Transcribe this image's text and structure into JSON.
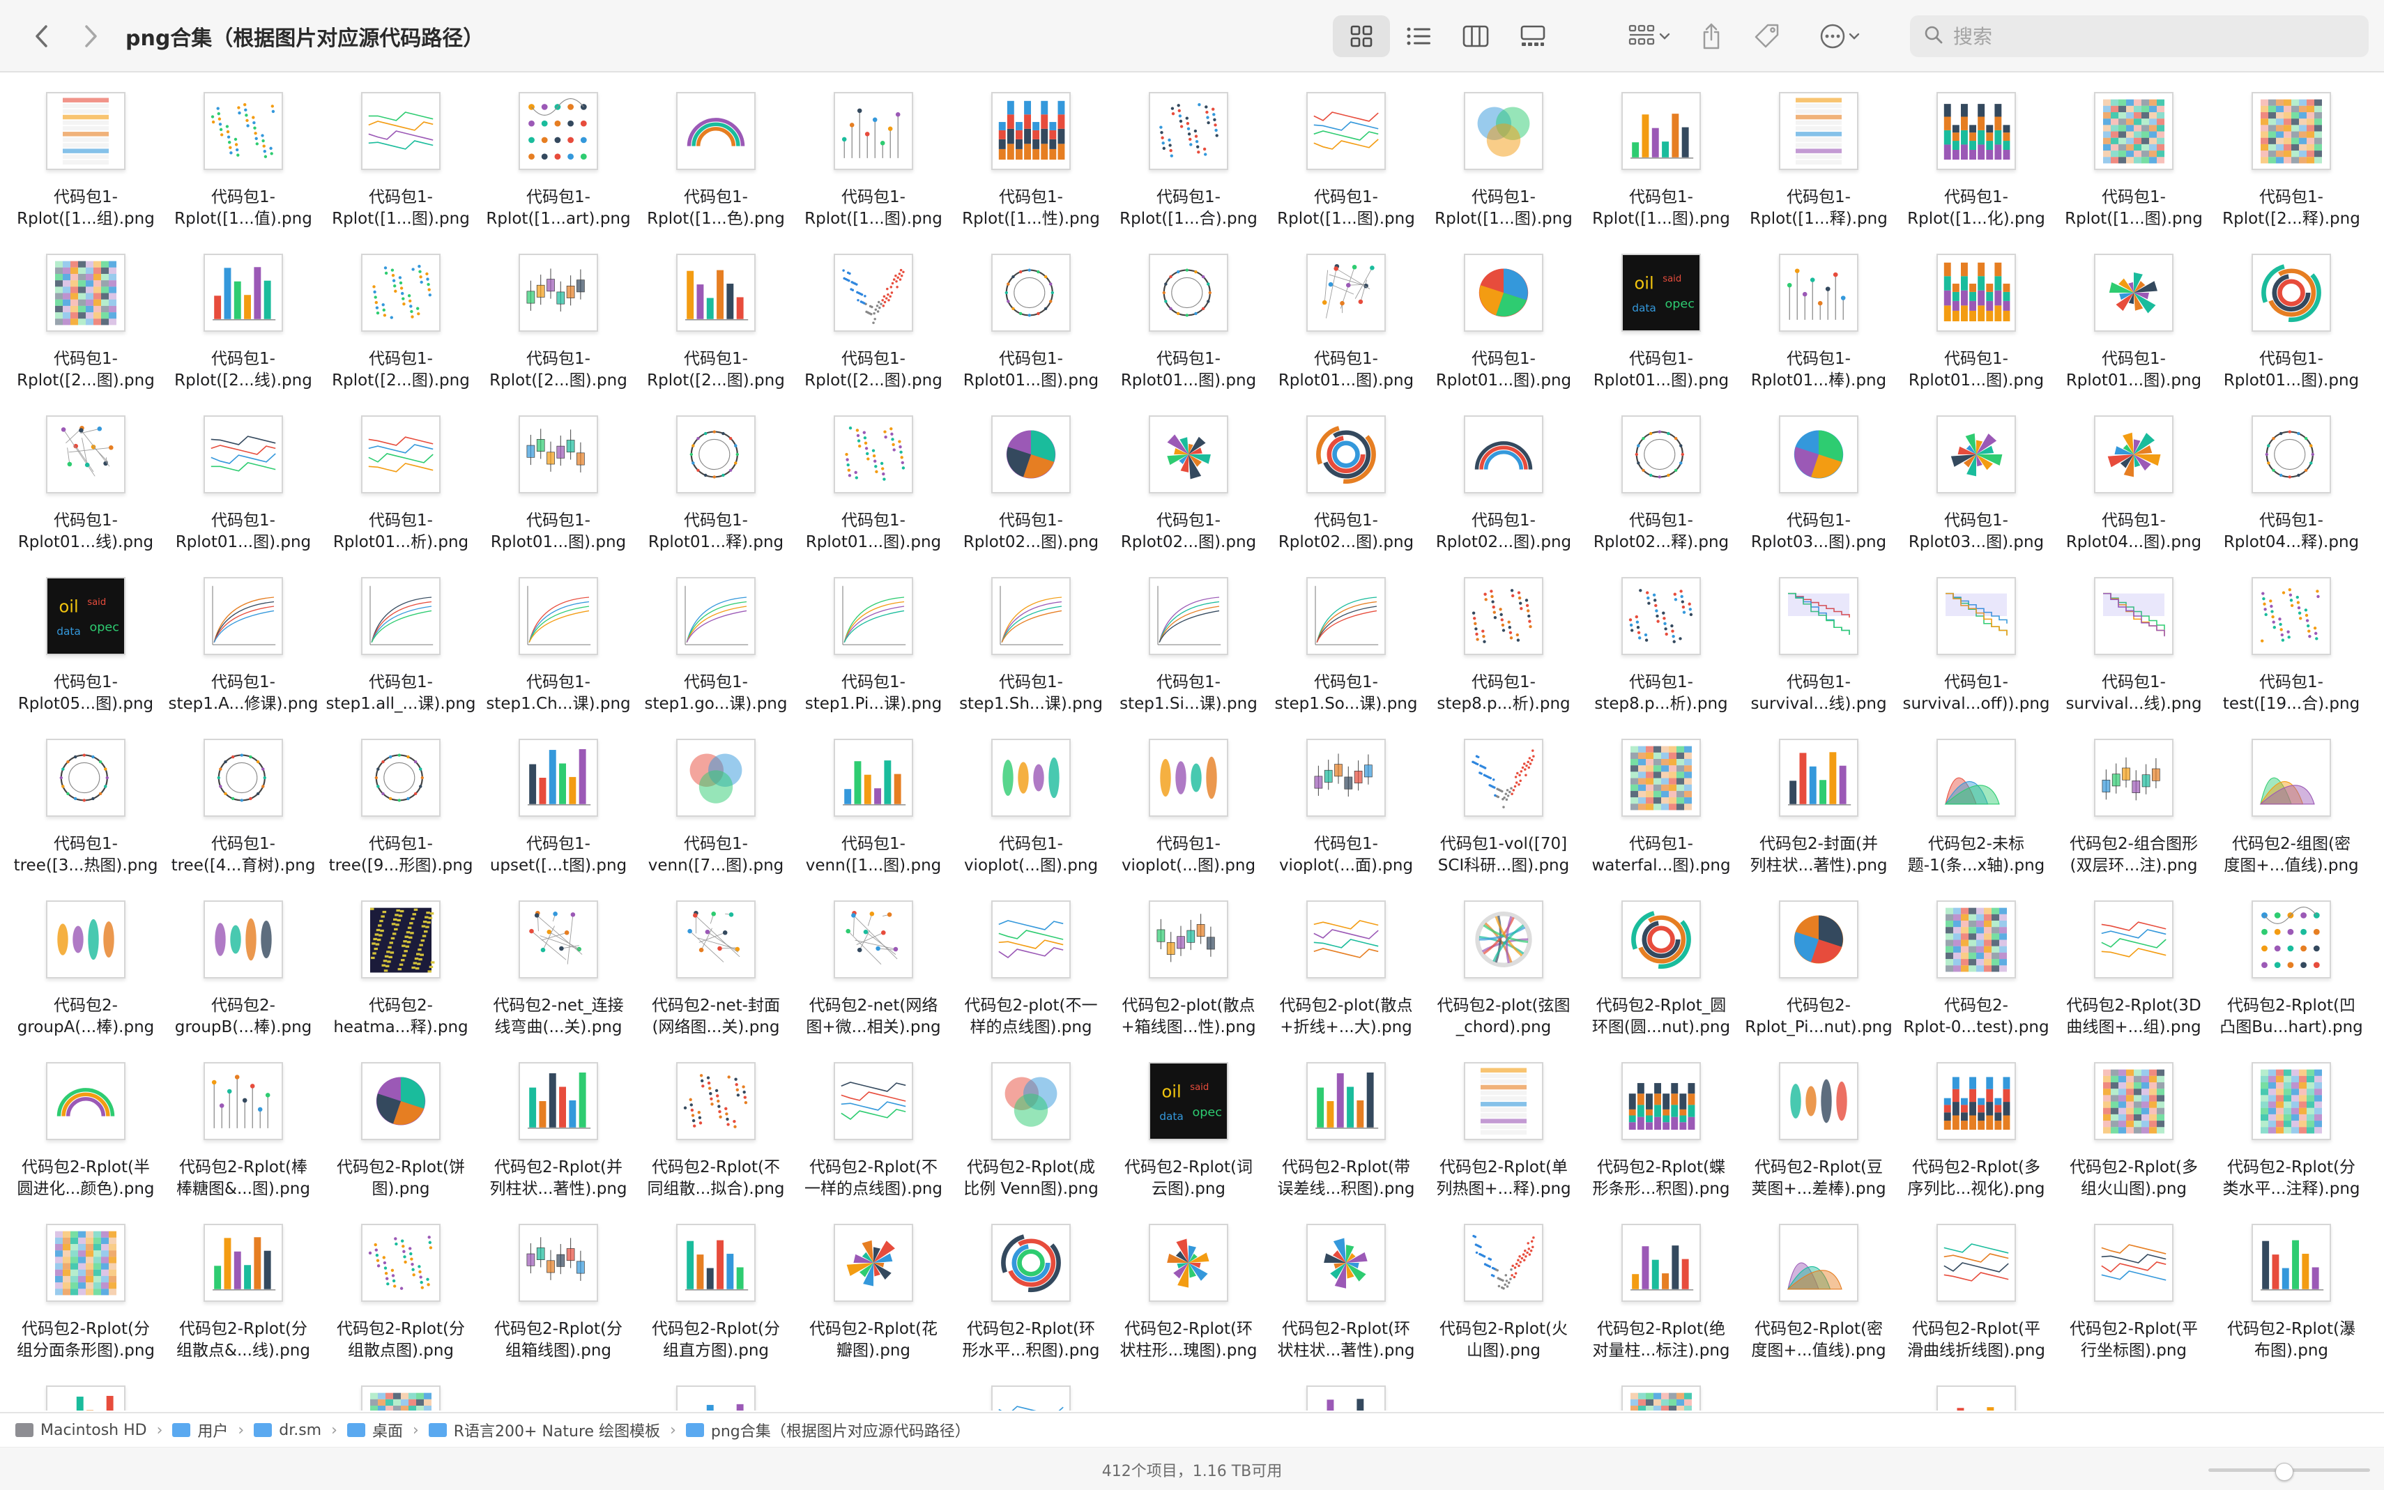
{
  "window": {
    "title": "png合集（根据图片对应源代码路径）"
  },
  "search": {
    "placeholder": "搜索"
  },
  "files": [
    {
      "l1": "代码包1-",
      "l2": "Rplot([1...组).png",
      "t": "table"
    },
    {
      "l1": "代码包1-",
      "l2": "Rplot([1...值).png",
      "t": "scatter"
    },
    {
      "l1": "代码包1-",
      "l2": "Rplot([1...图).png",
      "t": "lines"
    },
    {
      "l1": "代码包1-",
      "l2": "Rplot([1...art).png",
      "t": "dots"
    },
    {
      "l1": "代码包1-",
      "l2": "Rplot([1...色).png",
      "t": "arc"
    },
    {
      "l1": "代码包1-",
      "l2": "Rplot([1...图).png",
      "t": "lollipop"
    },
    {
      "l1": "代码包1-",
      "l2": "Rplot([1...性).png",
      "t": "stackbar"
    },
    {
      "l1": "代码包1-",
      "l2": "Rplot([1...合).png",
      "t": "scatter"
    },
    {
      "l1": "代码包1-",
      "l2": "Rplot([1...图).png",
      "t": "lines"
    },
    {
      "l1": "代码包1-",
      "l2": "Rplot([1...图).png",
      "t": "venn"
    },
    {
      "l1": "代码包1-",
      "l2": "Rplot([1...图).png",
      "t": "bar"
    },
    {
      "l1": "代码包1-",
      "l2": "Rplot([1...释).png",
      "t": "table"
    },
    {
      "l1": "代码包1-",
      "l2": "Rplot([1...化).png",
      "t": "stackbar"
    },
    {
      "l1": "代码包1-",
      "l2": "Rplot([1...图).png",
      "t": "heat"
    },
    {
      "l1": "代码包1-",
      "l2": "Rplot([2...释).png",
      "t": "heat"
    },
    {
      "l1": "代码包1-",
      "l2": "Rplot([2...图).png",
      "t": "heat"
    },
    {
      "l1": "代码包1-",
      "l2": "Rplot([2...线).png",
      "t": "bar"
    },
    {
      "l1": "代码包1-",
      "l2": "Rplot([2...图).png",
      "t": "scatter"
    },
    {
      "l1": "代码包1-",
      "l2": "Rplot([2...图).png",
      "t": "box"
    },
    {
      "l1": "代码包1-",
      "l2": "Rplot([2...图).png",
      "t": "bar"
    },
    {
      "l1": "代码包1-",
      "l2": "Rplot([2...图).png",
      "t": "volcano"
    },
    {
      "l1": "代码包1-",
      "l2": "Rplot01...图).png",
      "t": "circle"
    },
    {
      "l1": "代码包1-",
      "l2": "Rplot01...图).png",
      "t": "circle"
    },
    {
      "l1": "代码包1-",
      "l2": "Rplot01...图).png",
      "t": "network"
    },
    {
      "l1": "代码包1-",
      "l2": "Rplot01...图).png",
      "t": "pie"
    },
    {
      "l1": "代码包1-",
      "l2": "Rplot01...图).png",
      "t": "word"
    },
    {
      "l1": "代码包1-",
      "l2": "Rplot01...棒).png",
      "t": "lollipop"
    },
    {
      "l1": "代码包1-",
      "l2": "Rplot01...图).png",
      "t": "stackbar"
    },
    {
      "l1": "代码包1-",
      "l2": "Rplot01...图).png",
      "t": "rose"
    },
    {
      "l1": "代码包1-",
      "l2": "Rplot01...图).png",
      "t": "donut"
    },
    {
      "l1": "代码包1-",
      "l2": "Rplot01...线).png",
      "t": "network"
    },
    {
      "l1": "代码包1-",
      "l2": "Rplot01...图).png",
      "t": "lines"
    },
    {
      "l1": "代码包1-",
      "l2": "Rplot01...析).png",
      "t": "lines"
    },
    {
      "l1": "代码包1-",
      "l2": "Rplot01...图).png",
      "t": "box"
    },
    {
      "l1": "代码包1-",
      "l2": "Rplot01...释).png",
      "t": "circle"
    },
    {
      "l1": "代码包1-",
      "l2": "Rplot01...图).png",
      "t": "scatter"
    },
    {
      "l1": "代码包1-",
      "l2": "Rplot02...图).png",
      "t": "pie"
    },
    {
      "l1": "代码包1-",
      "l2": "Rplot02...图).png",
      "t": "rose"
    },
    {
      "l1": "代码包1-",
      "l2": "Rplot02...图).png",
      "t": "donut"
    },
    {
      "l1": "代码包1-",
      "l2": "Rplot02...图).png",
      "t": "arc"
    },
    {
      "l1": "代码包1-",
      "l2": "Rplot02...释).png",
      "t": "circle"
    },
    {
      "l1": "代码包1-",
      "l2": "Rplot03...图).png",
      "t": "pie"
    },
    {
      "l1": "代码包1-",
      "l2": "Rplot03...图).png",
      "t": "rose"
    },
    {
      "l1": "代码包1-",
      "l2": "Rplot04...图).png",
      "t": "rose"
    },
    {
      "l1": "代码包1-",
      "l2": "Rplot04...释).png",
      "t": "circle"
    },
    {
      "l1": "代码包1-",
      "l2": "Rplot05...图).png",
      "t": "word"
    },
    {
      "l1": "代码包1-",
      "l2": "step1.A...修课).png",
      "t": "curve"
    },
    {
      "l1": "代码包1-",
      "l2": "step1.all_...课).png",
      "t": "curve"
    },
    {
      "l1": "代码包1-",
      "l2": "step1.Ch...课).png",
      "t": "curve"
    },
    {
      "l1": "代码包1-",
      "l2": "step1.go...课).png",
      "t": "curve"
    },
    {
      "l1": "代码包1-",
      "l2": "step1.Pi...课).png",
      "t": "curve"
    },
    {
      "l1": "代码包1-",
      "l2": "step1.Sh...课).png",
      "t": "curve"
    },
    {
      "l1": "代码包1-",
      "l2": "step1.Si...课).png",
      "t": "curve"
    },
    {
      "l1": "代码包1-",
      "l2": "step1.So...课).png",
      "t": "curve"
    },
    {
      "l1": "代码包1-",
      "l2": "step8.p...析).png",
      "t": "scatter"
    },
    {
      "l1": "代码包1-",
      "l2": "step8.p...析).png",
      "t": "scatter"
    },
    {
      "l1": "代码包1-",
      "l2": "survival...线).png",
      "t": "survival"
    },
    {
      "l1": "代码包1-",
      "l2": "survival...off)).png",
      "t": "survival"
    },
    {
      "l1": "代码包1-",
      "l2": "survival...线).png",
      "t": "survival"
    },
    {
      "l1": "代码包1-",
      "l2": "test([19...合).png",
      "t": "scatter"
    },
    {
      "l1": "代码包1-",
      "l2": "tree([3...热图).png",
      "t": "circle"
    },
    {
      "l1": "代码包1-",
      "l2": "tree([4...育树).png",
      "t": "circle"
    },
    {
      "l1": "代码包1-",
      "l2": "tree([9...形图).png",
      "t": "circle"
    },
    {
      "l1": "代码包1-",
      "l2": "upset([...t图).png",
      "t": "bar"
    },
    {
      "l1": "代码包1-",
      "l2": "venn([7...图).png",
      "t": "venn"
    },
    {
      "l1": "代码包1-",
      "l2": "venn([1...图).png",
      "t": "bar"
    },
    {
      "l1": "代码包1-",
      "l2": "vioplot(...图).png",
      "t": "violin"
    },
    {
      "l1": "代码包1-",
      "l2": "vioplot(...图).png",
      "t": "violin"
    },
    {
      "l1": "代码包1-",
      "l2": "vioplot(...面).png",
      "t": "box"
    },
    {
      "l1": "代码包1-vol([70]",
      "l2": "SCI科研...图).png",
      "t": "volcano"
    },
    {
      "l1": "代码包1-",
      "l2": "waterfal...图).png",
      "t": "heat"
    },
    {
      "l1": "代码包2-封面(并",
      "l2": "列柱状...著性).png",
      "t": "bar"
    },
    {
      "l1": "代码包2-未标",
      "l2": "题-1(条...x轴).png",
      "t": "density"
    },
    {
      "l1": "代码包2-组合图形",
      "l2": "(双层环...注).png",
      "t": "box"
    },
    {
      "l1": "代码包2-组图(密",
      "l2": "度图+...值线).png",
      "t": "density"
    },
    {
      "l1": "代码包2-",
      "l2": "groupA(...棒).png",
      "t": "violin"
    },
    {
      "l1": "代码包2-",
      "l2": "groupB(...棒).png",
      "t": "violin"
    },
    {
      "l1": "代码包2-",
      "l2": "heatma...释).png",
      "t": "darkheat"
    },
    {
      "l1": "代码包2-net_连接",
      "l2": "线弯曲(...关).png",
      "t": "network"
    },
    {
      "l1": "代码包2-net-封面",
      "l2": "(网络图...关).png",
      "t": "network"
    },
    {
      "l1": "代码包2-net(网络",
      "l2": "图+微...相关).png",
      "t": "network"
    },
    {
      "l1": "代码包2-plot(不一",
      "l2": "样的点线图).png",
      "t": "lines"
    },
    {
      "l1": "代码包2-plot(散点",
      "l2": "+箱线图...性).png",
      "t": "box"
    },
    {
      "l1": "代码包2-plot(散点",
      "l2": "+折线+...大).png",
      "t": "lines"
    },
    {
      "l1": "代码包2-plot(弦图",
      "l2": "_chord).png",
      "t": "chord"
    },
    {
      "l1": "代码包2-Rplot_圆",
      "l2": "环图(圆...nut).png",
      "t": "donut"
    },
    {
      "l1": "代码包2-",
      "l2": "Rplot_Pi...nut).png",
      "t": "pie"
    },
    {
      "l1": "代码包2-",
      "l2": "Rplot-0...test).png",
      "t": "heat"
    },
    {
      "l1": "代码包2-Rplot(3D",
      "l2": "曲线图+...组).png",
      "t": "lines"
    },
    {
      "l1": "代码包2-Rplot(凹",
      "l2": "凸图Bu...hart).png",
      "t": "dots"
    },
    {
      "l1": "代码包2-Rplot(半",
      "l2": "圆进化...颜色).png",
      "t": "arc"
    },
    {
      "l1": "代码包2-Rplot(棒",
      "l2": "棒糖图&...图).png",
      "t": "lollipop"
    },
    {
      "l1": "代码包2-Rplot(饼",
      "l2": "图).png",
      "t": "pie"
    },
    {
      "l1": "代码包2-Rplot(并",
      "l2": "列柱状...著性).png",
      "t": "bar"
    },
    {
      "l1": "代码包2-Rplot(不",
      "l2": "同组散...拟合).png",
      "t": "scatter"
    },
    {
      "l1": "代码包2-Rplot(不",
      "l2": "一样的点线图).png",
      "t": "lines"
    },
    {
      "l1": "代码包2-Rplot(成",
      "l2": "比例 Venn图).png",
      "t": "venn"
    },
    {
      "l1": "代码包2-Rplot(词",
      "l2": "云图).png",
      "t": "word"
    },
    {
      "l1": "代码包2-Rplot(带",
      "l2": "误差线...积图).png",
      "t": "bar"
    },
    {
      "l1": "代码包2-Rplot(单",
      "l2": "列热图+...释).png",
      "t": "table"
    },
    {
      "l1": "代码包2-Rplot(蝶",
      "l2": "形条形...积图).png",
      "t": "stackbar"
    },
    {
      "l1": "代码包2-Rplot(豆",
      "l2": "荚图+...差棒).png",
      "t": "violin"
    },
    {
      "l1": "代码包2-Rplot(多",
      "l2": "序列比...视化).png",
      "t": "stackbar"
    },
    {
      "l1": "代码包2-Rplot(多",
      "l2": "组火山图).png",
      "t": "heat"
    },
    {
      "l1": "代码包2-Rplot(分",
      "l2": "类水平...注释).png",
      "t": "heat"
    },
    {
      "l1": "代码包2-Rplot(分",
      "l2": "组分面条形图).png",
      "t": "heat"
    },
    {
      "l1": "代码包2-Rplot(分",
      "l2": "组散点&...线).png",
      "t": "bar"
    },
    {
      "l1": "代码包2-Rplot(分",
      "l2": "组散点图).png",
      "t": "scatter"
    },
    {
      "l1": "代码包2-Rplot(分",
      "l2": "组箱线图).png",
      "t": "box"
    },
    {
      "l1": "代码包2-Rplot(分",
      "l2": "组直方图).png",
      "t": "bar"
    },
    {
      "l1": "代码包2-Rplot(花",
      "l2": "瓣图).png",
      "t": "rose"
    },
    {
      "l1": "代码包2-Rplot(环",
      "l2": "形水平...积图).png",
      "t": "donut"
    },
    {
      "l1": "代码包2-Rplot(环",
      "l2": "状柱形...瑰图).png",
      "t": "rose"
    },
    {
      "l1": "代码包2-Rplot(环",
      "l2": "状柱状...著性).png",
      "t": "rose"
    },
    {
      "l1": "代码包2-Rplot(火",
      "l2": "山图).png",
      "t": "volcano"
    },
    {
      "l1": "代码包2-Rplot(绝",
      "l2": "对量柱...标注).png",
      "t": "bar"
    },
    {
      "l1": "代码包2-Rplot(密",
      "l2": "度图+...值线).png",
      "t": "density"
    },
    {
      "l1": "代码包2-Rplot(平",
      "l2": "滑曲线折线图).png",
      "t": "lines"
    },
    {
      "l1": "代码包2-Rplot(平",
      "l2": "行坐标图).png",
      "t": "lines"
    },
    {
      "l1": "代码包2-Rplot(瀑",
      "l2": "布图).png",
      "t": "bar"
    }
  ],
  "path_bar": {
    "items": [
      "Macintosh HD",
      "用户",
      "dr.sm",
      "桌面",
      "R语言200+ Nature 绘图模板",
      "png合集（根据图片对应源代码路径）"
    ]
  },
  "status": {
    "text": "412个项目，1.16 TB可用"
  },
  "colors": {
    "folder": "#5aa9f0",
    "disk": "#8e8e93",
    "accent": "#007aff"
  },
  "icons": [
    "chevron-left-icon",
    "chevron-right-icon",
    "grid-view-icon",
    "list-view-icon",
    "column-view-icon",
    "gallery-view-icon",
    "group-icon",
    "share-icon",
    "tag-icon",
    "more-icon",
    "search-icon"
  ]
}
